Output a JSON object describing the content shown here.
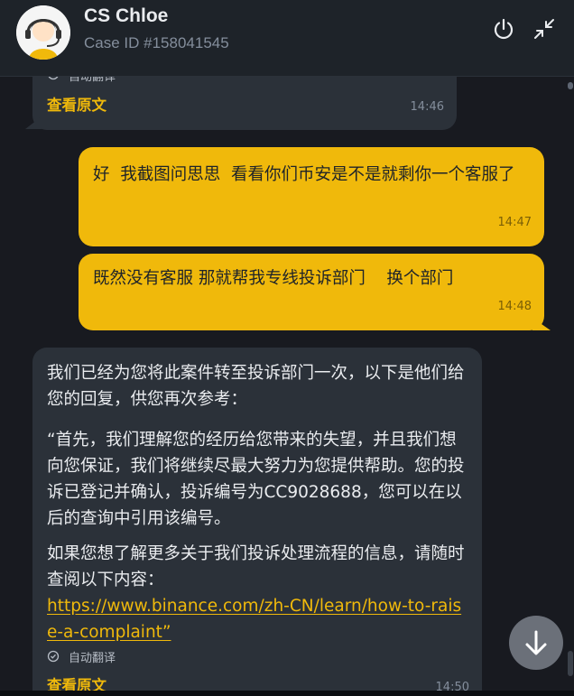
{
  "header": {
    "agent_name": "CS Chloe",
    "case_id": "Case ID #158041545"
  },
  "messages": [
    {
      "direction": "incoming",
      "partial_top_text": "自动翻译",
      "view_original": "查看原文",
      "time": "14:46"
    },
    {
      "direction": "outgoing",
      "text": "好  我截图问思思  看看你们币安是不是就剩你一个客服了",
      "time": "14:47"
    },
    {
      "direction": "outgoing",
      "text": "既然没有客服 那就帮我专线投诉部门    换个部门",
      "time": "14:48"
    },
    {
      "direction": "incoming",
      "para1": "我们已经为您将此案件转至投诉部门一次，以下是他们给您的回复，供您再次参考：",
      "para2": "“首先，我们理解您的经历给您带来的失望，并且我们想向您保证，我们将继续尽最大努力为您提供帮助。您的投诉已登记并确认，投诉编号为CC9028688，您可以在以后的查询中引用该编号。",
      "para3": "如果您想了解更多关于我们投诉处理流程的信息，请随时查阅以下内容：",
      "link": "https://www.binance.com/zh-CN/learn/how-to-raise-a-complaint”",
      "auto_translated": "自动翻译",
      "view_original": "查看原文",
      "time": "14:50"
    }
  ],
  "colors": {
    "background": "#181a20",
    "header": "#1e2329",
    "incoming_bubble": "#2b3139",
    "outgoing_bubble": "#f0b90b",
    "accent": "#f0b90b"
  },
  "icons": {
    "power": "power-icon",
    "minimize": "minimize-icon",
    "scroll_down": "arrow-down-icon",
    "translate_check": "check-circle-icon"
  }
}
